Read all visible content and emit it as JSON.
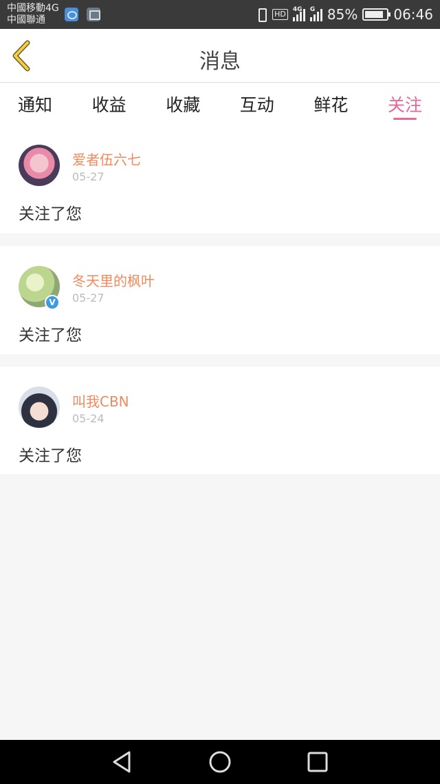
{
  "status_bar": {
    "carrier_1": "中國移動4G",
    "carrier_2": "中國聯通",
    "hd": "HD",
    "net_4g": "4G",
    "net_g": "G",
    "battery": "85%",
    "battery_level": 0.85,
    "time": "06:46",
    "icons": [
      "app-notification-icon",
      "gallery-icon",
      "vibrate-icon",
      "signal-icon",
      "battery-icon"
    ]
  },
  "header": {
    "title": "消息",
    "back_icon": "chevron-left-icon",
    "back_color": "#d4a92a"
  },
  "tabs": [
    {
      "label": "通知",
      "active": false
    },
    {
      "label": "收益",
      "active": false
    },
    {
      "label": "收藏",
      "active": false
    },
    {
      "label": "互动",
      "active": false
    },
    {
      "label": "鲜花",
      "active": false
    },
    {
      "label": "关注",
      "active": true
    }
  ],
  "colors": {
    "accent": "#e8679a",
    "username": "#f08a5d",
    "verified": "#3d9be0"
  },
  "messages": [
    {
      "username": "爱者伍六七",
      "date": "05-27",
      "text": "关注了您",
      "verified": false
    },
    {
      "username": "冬天里的枫叶",
      "date": "05-27",
      "text": "关注了您",
      "verified": true,
      "badge": "V"
    },
    {
      "username": "叫我CBN",
      "date": "05-24",
      "text": "关注了您",
      "verified": false
    }
  ],
  "nav_bar": [
    "back-triangle-icon",
    "home-circle-icon",
    "recents-square-icon"
  ]
}
